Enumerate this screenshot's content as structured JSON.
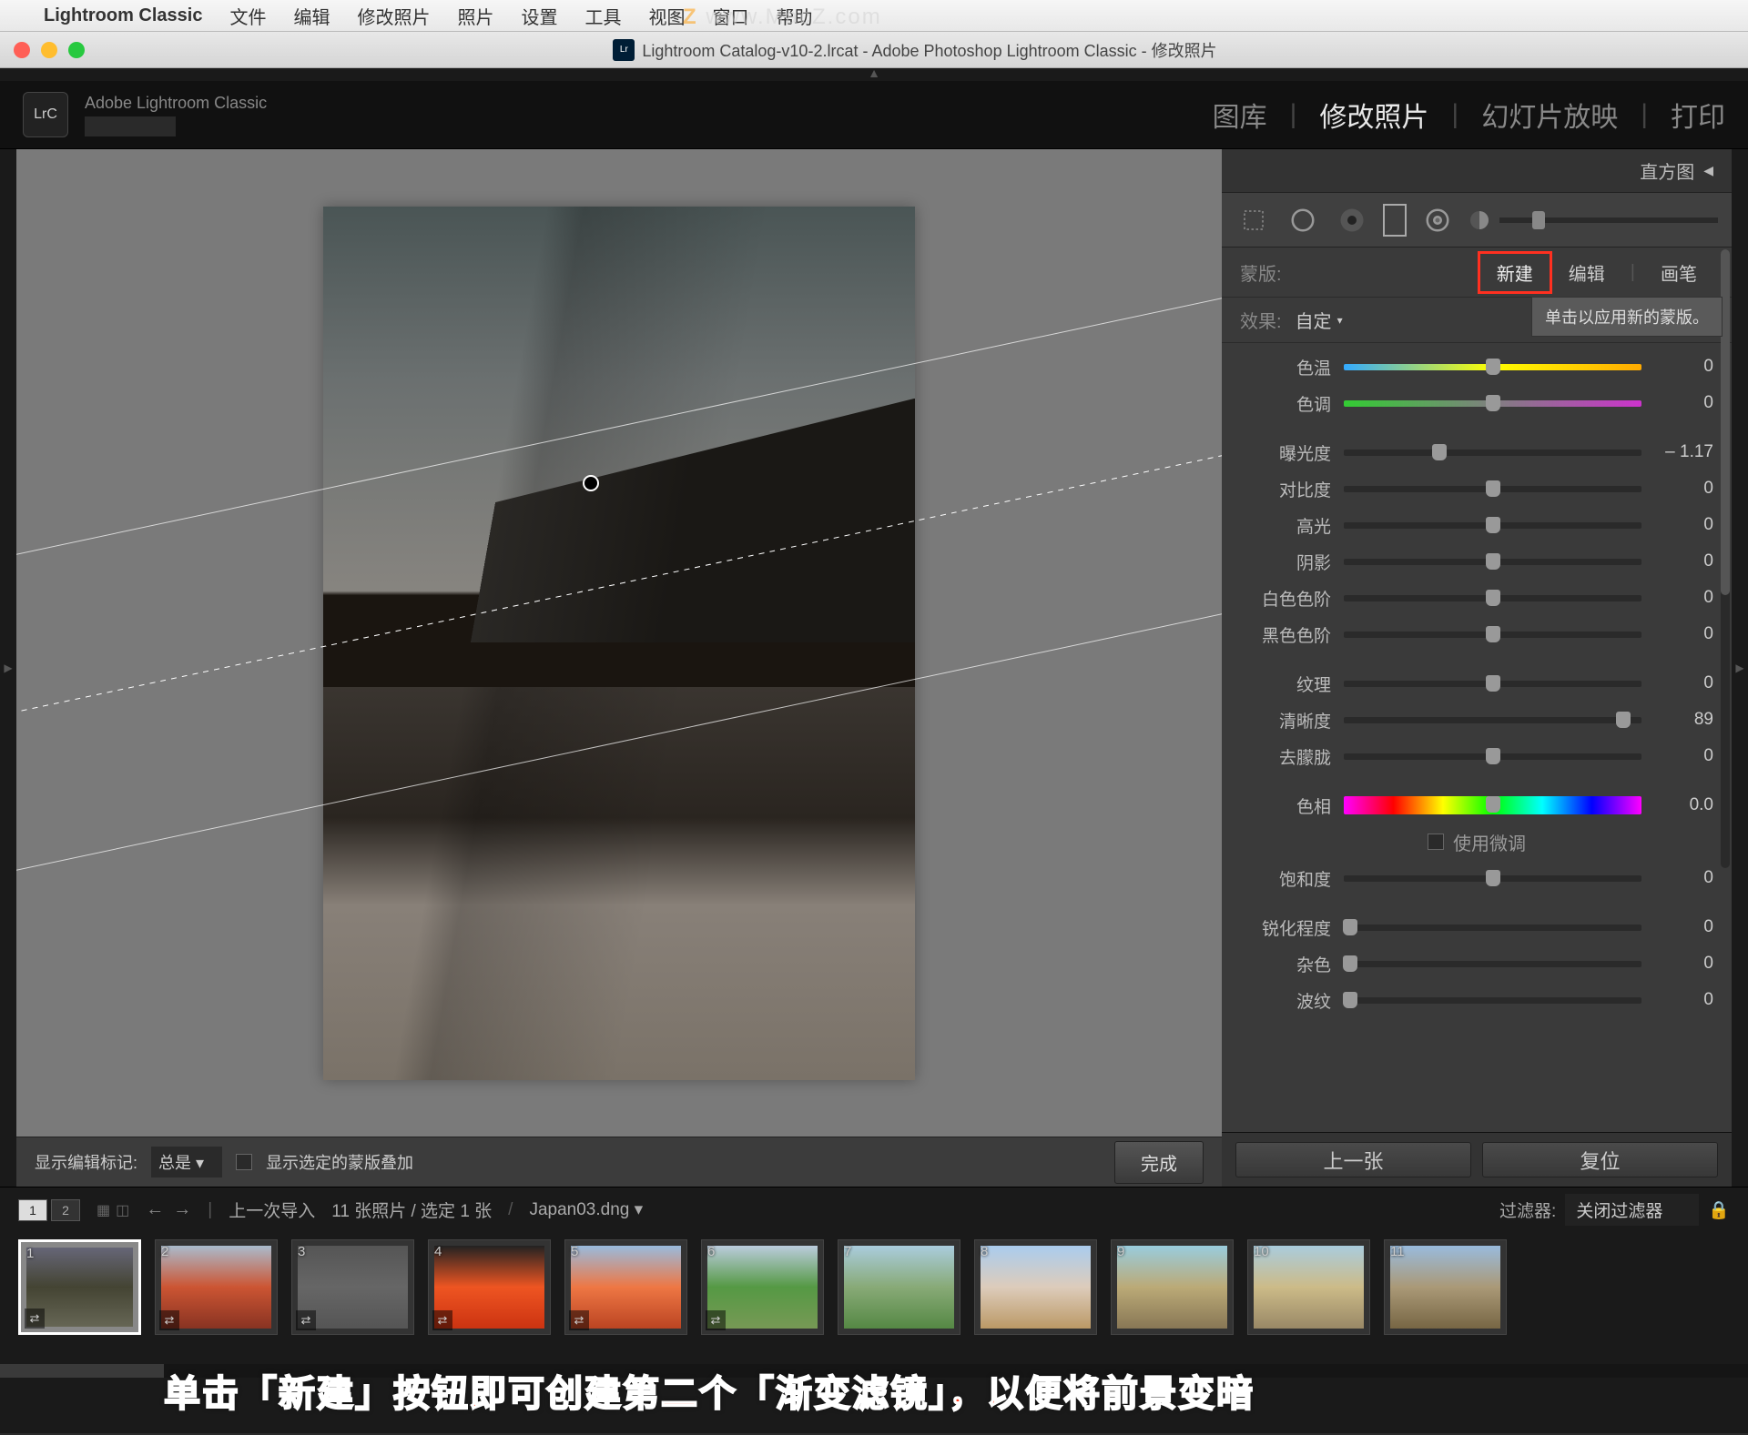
{
  "mac_menu": {
    "app": "Lightroom Classic",
    "items": [
      "文件",
      "编辑",
      "修改照片",
      "照片",
      "设置",
      "工具",
      "视图",
      "窗口",
      "帮助"
    ]
  },
  "watermark": "www.MacZ.com",
  "window_title": "Lightroom Catalog-v10-2.lrcat - Adobe Photoshop Lightroom Classic - 修改照片",
  "identity_plate": "Adobe Lightroom Classic",
  "lrc": "LrC",
  "modules": {
    "library": "图库",
    "develop": "修改照片",
    "slideshow": "幻灯片放映",
    "print": "打印"
  },
  "right_panel": {
    "histogram": "直方图",
    "mask_label": "蒙版:",
    "mask_new": "新建",
    "mask_edit": "编辑",
    "mask_brush": "画笔",
    "tooltip": "单击以应用新的蒙版。",
    "effect_label": "效果:",
    "effect_value": "自定",
    "sliders": [
      {
        "label": "色温",
        "val": "0",
        "pos": 50,
        "cls": "temp"
      },
      {
        "label": "色调",
        "val": "0",
        "pos": 50,
        "cls": "tint"
      },
      {
        "gap": true
      },
      {
        "label": "曝光度",
        "val": "– 1.17",
        "pos": 32
      },
      {
        "label": "对比度",
        "val": "0",
        "pos": 50
      },
      {
        "label": "高光",
        "val": "0",
        "pos": 50
      },
      {
        "label": "阴影",
        "val": "0",
        "pos": 50
      },
      {
        "label": "白色色阶",
        "val": "0",
        "pos": 50
      },
      {
        "label": "黑色色阶",
        "val": "0",
        "pos": 50
      },
      {
        "gap": true
      },
      {
        "label": "纹理",
        "val": "0",
        "pos": 50
      },
      {
        "label": "清晰度",
        "val": "89",
        "pos": 94
      },
      {
        "label": "去朦胧",
        "val": "0",
        "pos": 50
      },
      {
        "gap": true
      },
      {
        "label": "色相",
        "val": "0.0",
        "pos": 50,
        "cls": "hue"
      },
      {
        "finetune": true,
        "label": "使用微调"
      },
      {
        "label": "饱和度",
        "val": "0",
        "pos": 50
      },
      {
        "gap": true
      },
      {
        "label": "锐化程度",
        "val": "0",
        "pos": 2
      },
      {
        "label": "杂色",
        "val": "0",
        "pos": 2
      },
      {
        "label": "波纹",
        "val": "0",
        "pos": 2
      }
    ],
    "prev": "上一张",
    "reset": "复位"
  },
  "canvas_bar": {
    "show_edit_label": "显示编辑标记:",
    "show_edit_value": "总是",
    "overlay": "显示选定的蒙版叠加",
    "done": "完成"
  },
  "filter_bar": {
    "tab1": "1",
    "tab2": "2",
    "breadcrumb": "上一次导入",
    "count": "11 张照片 / 选定 1 张",
    "filename": "Japan03.dng",
    "filter_label": "过滤器:",
    "filter_value": "关闭过滤器"
  },
  "thumbs": [
    "1",
    "2",
    "3",
    "4",
    "5",
    "6",
    "7",
    "8",
    "9",
    "10",
    "11"
  ],
  "annotation": "单击「新建」按钮即可创建第二个「渐变滤镜」，以便将前景变暗"
}
